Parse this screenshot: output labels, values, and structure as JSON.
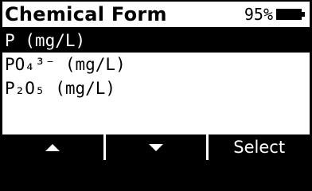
{
  "header": {
    "title": "Chemical Form",
    "battery_percent": "95%"
  },
  "options": [
    {
      "label": "P (mg/L)",
      "selected": true
    },
    {
      "label": "PO₄³⁻ (mg/L)",
      "selected": false
    },
    {
      "label": "P₂O₅ (mg/L)",
      "selected": false
    }
  ],
  "softkeys": {
    "left_icon": "up-arrow-icon",
    "middle_icon": "down-arrow-icon",
    "right_label": "Select"
  },
  "colors": {
    "foreground": "#000000",
    "background": "#ffffff"
  }
}
